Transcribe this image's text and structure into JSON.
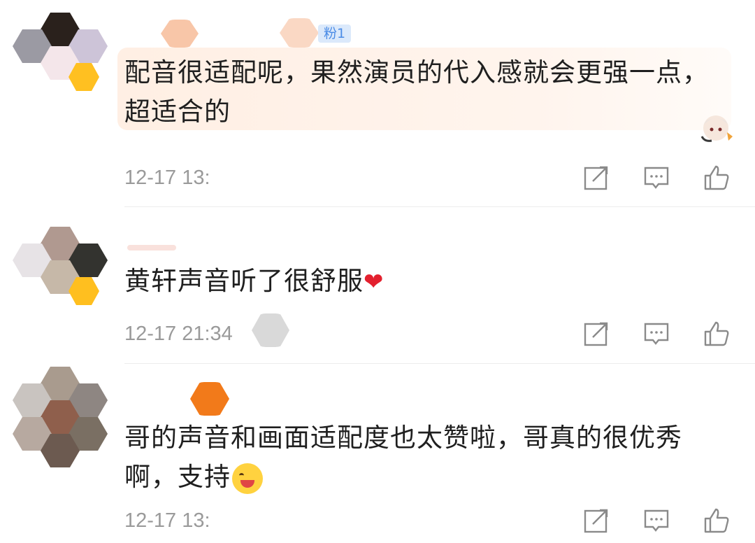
{
  "comments": [
    {
      "text": "配音很适配呢，果然演员的代入感就会更强一点，\n超适合的",
      "time": "12-17 13:",
      "badge": "粉1"
    },
    {
      "text": "黄轩声音听了很舒服",
      "emoji": "❤",
      "time": "12-17 21:34"
    },
    {
      "text": "哥的声音和画面适配度也太赞啦，哥真的很优秀\n啊，支持",
      "time": "12-17 13:"
    }
  ],
  "icons": {
    "share": "share-icon",
    "reply": "comment-icon",
    "like": "thumbs-up-icon"
  },
  "colors": {
    "text": "#1f1f1f",
    "meta": "#9a9a9a",
    "heart": "#e3202e",
    "badge": "#4b8ce6"
  }
}
